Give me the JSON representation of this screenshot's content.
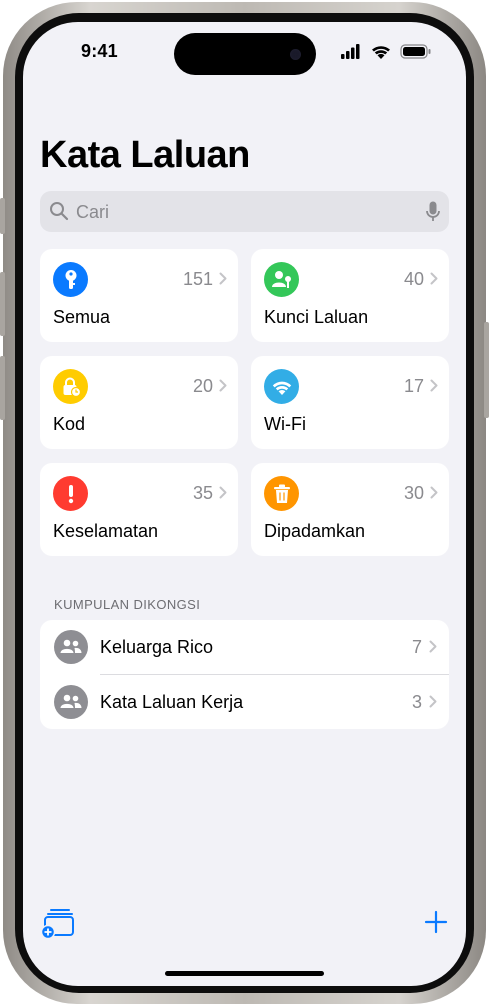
{
  "status_bar": {
    "time": "9:41"
  },
  "page": {
    "title": "Kata Laluan"
  },
  "search": {
    "placeholder": "Cari"
  },
  "categories": [
    {
      "label": "Semua",
      "count": "151",
      "icon": "key-icon",
      "color": "#0a7aff"
    },
    {
      "label": "Kunci Laluan",
      "count": "40",
      "icon": "person-key-icon",
      "color": "#34c759"
    },
    {
      "label": "Kod",
      "count": "20",
      "icon": "lock-clock-icon",
      "color": "#ffcc00"
    },
    {
      "label": "Wi-Fi",
      "count": "17",
      "icon": "wifi-icon",
      "color": "#32ade6"
    },
    {
      "label": "Keselamatan",
      "count": "35",
      "icon": "exclamation-icon",
      "color": "#ff3b30"
    },
    {
      "label": "Dipadamkan",
      "count": "30",
      "icon": "trash-icon",
      "color": "#ff9500"
    }
  ],
  "shared_groups": {
    "header": "KUMPULAN DIKONGSI",
    "items": [
      {
        "label": "Keluarga Rico",
        "count": "7",
        "icon": "people-icon"
      },
      {
        "label": "Kata Laluan Kerja",
        "count": "3",
        "icon": "people-icon"
      }
    ]
  },
  "toolbar": {
    "new_group_icon": "new-group-icon",
    "add_icon": "plus-icon",
    "accent": "#0a7aff"
  }
}
